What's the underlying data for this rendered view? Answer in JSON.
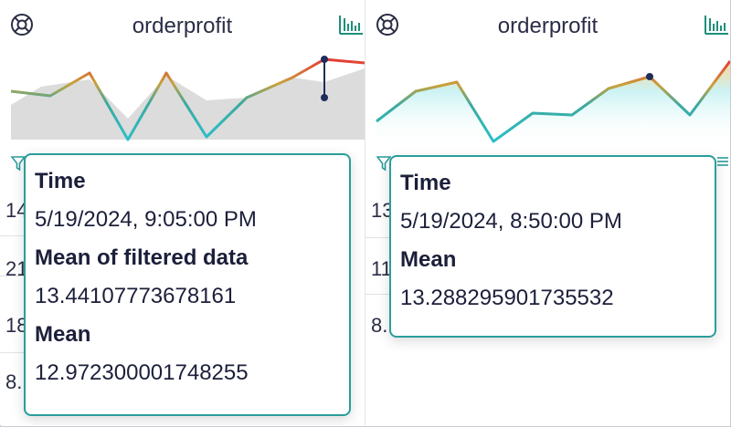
{
  "panels": [
    {
      "title": "orderprofit",
      "icons": {
        "left": "target-icon",
        "right": "bar-chart-icon",
        "filter": "filter-icon"
      },
      "row_values": [
        "14",
        "21",
        "18",
        "8."
      ],
      "tooltip": {
        "rows": [
          {
            "label": "Time",
            "value": "5/19/2024, 9:05:00 PM"
          },
          {
            "label": "Mean of filtered data",
            "value": "13.44107773678161"
          },
          {
            "label": "Mean",
            "value": "12.972300001748255"
          }
        ]
      }
    },
    {
      "title": "orderprofit",
      "icons": {
        "left": "target-icon",
        "right": "bar-chart-icon",
        "filter": "filter-icon",
        "menu": "menu-icon"
      },
      "row_values": [
        "13",
        "11",
        "8."
      ],
      "tooltip": {
        "rows": [
          {
            "label": "Time",
            "value": "5/19/2024, 8:50:00 PM"
          },
          {
            "label": "Mean",
            "value": "13.288295901735532"
          }
        ]
      }
    }
  ],
  "colors": {
    "accent": "#2a9d9b",
    "line_high": "#e53935",
    "line_mid": "#c9a23b",
    "line_low": "#2bbfc9",
    "marker": "#1f2d5a",
    "area_gray": "#dcdcdc"
  }
}
